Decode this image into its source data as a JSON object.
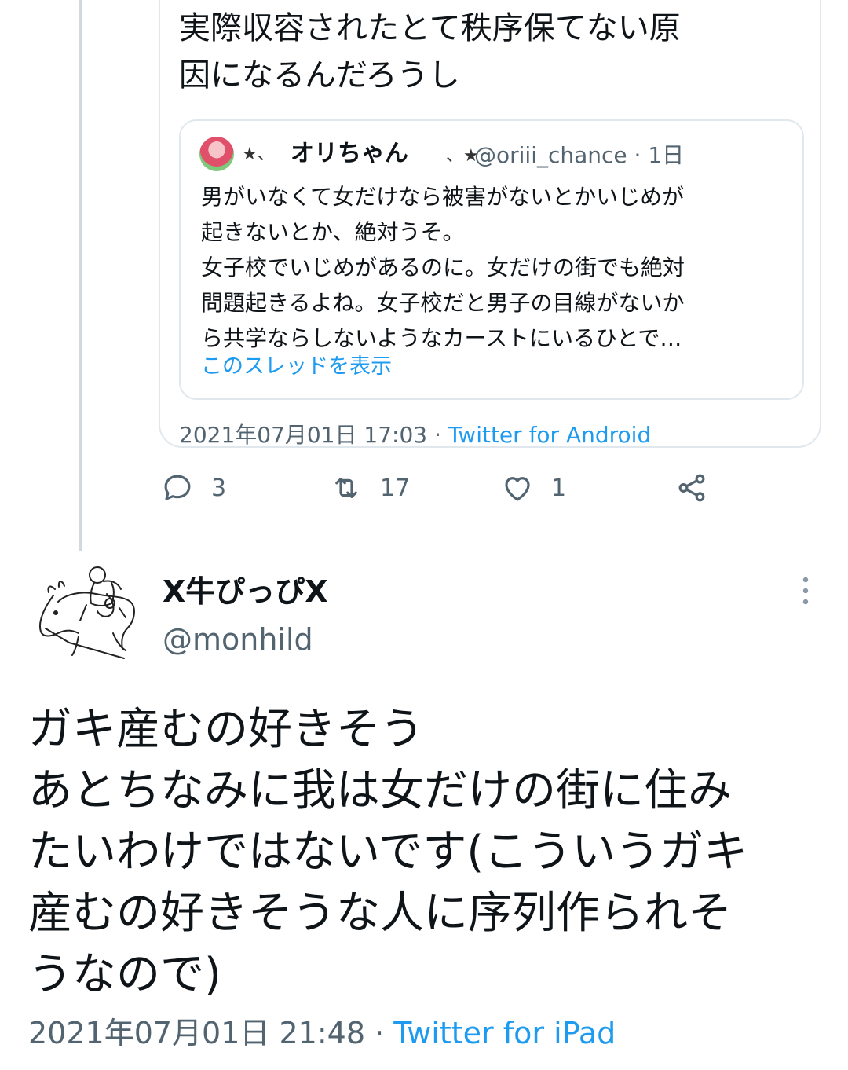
{
  "quoted_tweet": {
    "text": "実際収容されたとて秩序保てない原\n因になるんだろうし",
    "timestamp": "2021年07月01日 17:03",
    "separator": "·",
    "source": "Twitter for Android",
    "embedded": {
      "deco_left": "★、",
      "name": "オリちゃん",
      "deco_right": "、★",
      "handle_time": "@oriii_chance · 1日",
      "text": "男がいなくて女だけなら被害がないとかいじめが\n起きないとか、絶対うそ。\n女子校でいじめがあるのに。女だけの街でも絶対\n問題起きるよね。女子校だと男子の目線がないか\nら共学ならしないようなカーストにいるひとで…",
      "show_thread": "このスレッドを表示"
    }
  },
  "actions": {
    "reply_count": "3",
    "retweet_count": "17",
    "like_count": "1"
  },
  "tweet": {
    "author_name": "X牛ぴっぴX",
    "author_handle": "@monhild",
    "text": "ガキ産むの好きそう\nあとちなみに我は女だけの街に住み\nたいわけではないです(こういうガキ\n産むの好きそうな人に序列作られそ\nうなので)",
    "timestamp": "2021年07月01日 21:48",
    "separator": "·",
    "source": "Twitter for iPad"
  },
  "colors": {
    "link": "#1d9bf0",
    "secondary_text": "#536471",
    "border": "#e1e8ed"
  },
  "icons": [
    "reply-icon",
    "retweet-icon",
    "like-icon",
    "share-icon",
    "more-icon"
  ]
}
